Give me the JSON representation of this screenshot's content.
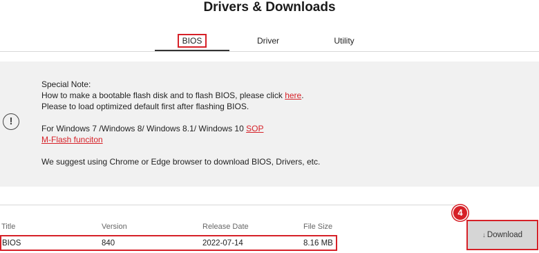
{
  "page": {
    "title": "Drivers & Downloads"
  },
  "tabs": [
    {
      "label": "BIOS",
      "active": true
    },
    {
      "label": "Driver",
      "active": false
    },
    {
      "label": "Utility",
      "active": false
    }
  ],
  "note": {
    "icon": "exclamation-circle-icon",
    "heading": "Special Note:",
    "line1_prefix": "How to make a bootable flash disk and to flash BIOS, please click ",
    "line1_link": "here",
    "line1_suffix": ".",
    "line2": "Please to load optimized default first after flashing BIOS.",
    "line3_prefix": "For Windows 7 /Windows 8/ Windows 8.1/ Windows 10 ",
    "line3_link": "SOP",
    "line4_link": "M-Flash funciton",
    "line5": "We suggest using Chrome or Edge browser to download BIOS, Drivers, etc."
  },
  "table": {
    "headers": {
      "title": "Title",
      "version": "Version",
      "release_date": "Release Date",
      "file_size": "File Size"
    },
    "rows": [
      {
        "title": "BIOS",
        "version": "840",
        "release_date": "2022-07-14",
        "file_size": "8.16 MB"
      }
    ]
  },
  "download": {
    "label": "Download",
    "icon": "download-arrow-icon",
    "step": "4"
  },
  "colors": {
    "accent": "#d62027",
    "note_bg": "#f1f1f1",
    "button_bg": "#d6d6d6"
  }
}
